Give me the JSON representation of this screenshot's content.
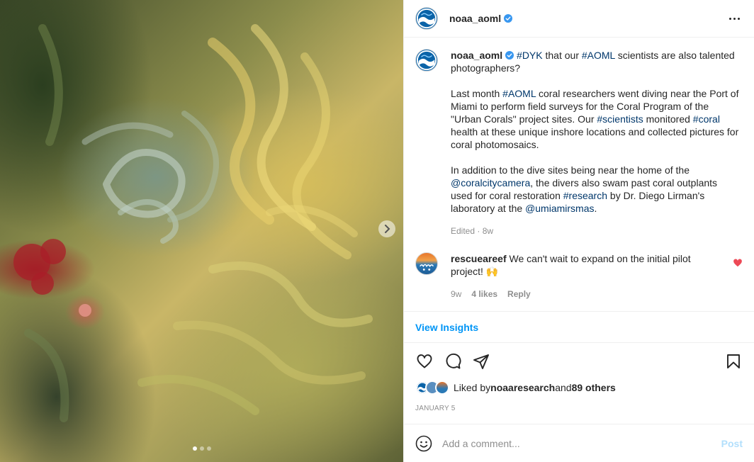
{
  "post": {
    "author": "noaa_aoml",
    "verified": true,
    "more_icon": "more-horizontal-icon"
  },
  "media": {
    "next_icon": "chevron-right-icon",
    "carousel_count": 3,
    "carousel_active": 1
  },
  "caption": {
    "author": "noaa_aoml",
    "p1": [
      {
        "t": "#DYK",
        "tag": true
      },
      {
        "t": " that our ",
        "tag": false
      },
      {
        "t": "#AOML",
        "tag": true
      },
      {
        "t": " scientists are also talented photographers?",
        "tag": false
      }
    ],
    "p2": [
      {
        "t": "Last month ",
        "tag": false
      },
      {
        "t": "#AOML",
        "tag": true
      },
      {
        "t": " coral researchers went diving near the Port of Miami to perform field surveys for the Coral Program of the \"Urban Corals'' project sites. Our ",
        "tag": false
      },
      {
        "t": "#scientists",
        "tag": true
      },
      {
        "t": " monitored ",
        "tag": false
      },
      {
        "t": "#coral",
        "tag": true
      },
      {
        "t": " health at these unique inshore locations and collected pictures for coral photomosaics.",
        "tag": false
      }
    ],
    "p3": [
      {
        "t": "In addition to the dive sites being near the home of the ",
        "tag": false
      },
      {
        "t": "@coralcitycamera",
        "tag": true
      },
      {
        "t": ", the divers also swam past coral outplants used for coral restoration ",
        "tag": false
      },
      {
        "t": "#research",
        "tag": true
      },
      {
        "t": " by Dr. Diego Lirman's laboratory at the ",
        "tag": false
      },
      {
        "t": "@umiamirsmas",
        "tag": true
      },
      {
        "t": ".",
        "tag": false
      }
    ],
    "meta": "Edited · 8w"
  },
  "comment": {
    "author": "rescueareef",
    "text": "We can't wait to expand on the initial pilot project! 🙌",
    "age": "9w",
    "likes": "4 likes",
    "reply": "Reply",
    "liked": true,
    "heart_color": "#ed4956"
  },
  "insights_label": "View Insights",
  "likes": {
    "prefix": "Liked by ",
    "first": "noaaresearch",
    "mid": " and ",
    "others": "89 others"
  },
  "date": "JANUARY 5",
  "add_comment": {
    "placeholder": "Add a comment...",
    "post_label": "Post",
    "emoji_icon": "emoji-icon"
  },
  "colors": {
    "link": "#00376b",
    "accent": "#0095f6",
    "muted": "#8e8e8e",
    "post_disabled": "#b2dffc",
    "noaa_blue": "#0a63a8"
  }
}
